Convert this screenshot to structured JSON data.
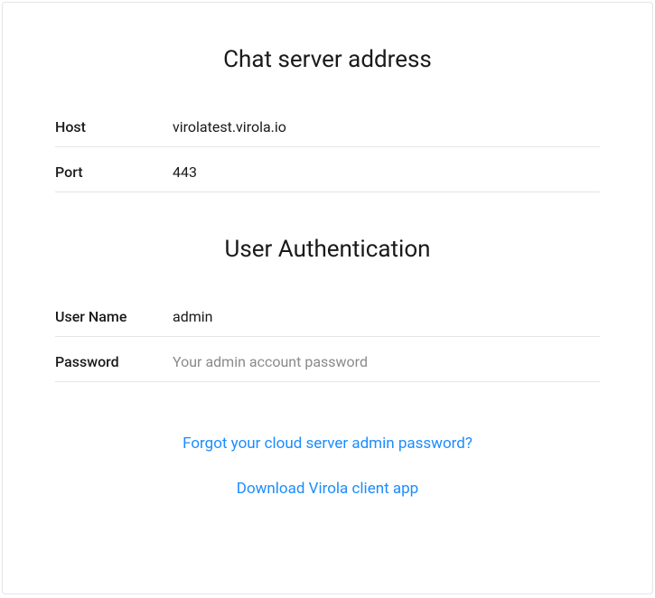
{
  "server": {
    "title": "Chat server address",
    "host_label": "Host",
    "host_value": "virolatest.virola.io",
    "port_label": "Port",
    "port_value": "443"
  },
  "auth": {
    "title": "User Authentication",
    "username_label": "User Name",
    "username_value": "admin",
    "password_label": "Password",
    "password_placeholder": "Your admin account password"
  },
  "links": {
    "forgot_password": "Forgot your cloud server admin password?",
    "download_client": "Download Virola client app"
  }
}
